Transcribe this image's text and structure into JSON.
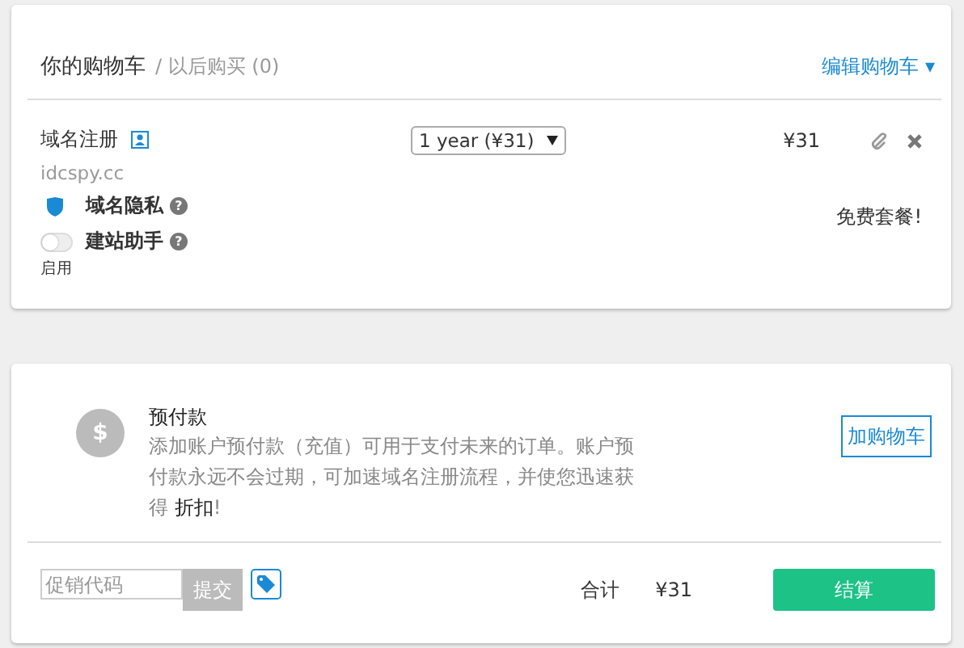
{
  "cart": {
    "title": "你的购物车",
    "later": "/ 以后购买 (0)",
    "edit": "编辑购物车",
    "edit_caret": "▾",
    "items": [
      {
        "name": "域名注册",
        "domain": "idcspy.cc",
        "period": "1 year (¥31)",
        "price": "¥31",
        "note": "免费套餐!",
        "addons": [
          {
            "kind": "shield",
            "label": "域名隐私",
            "help": "?"
          },
          {
            "kind": "toggle",
            "label": "建站助手",
            "help": "?",
            "on": false,
            "toggle_label": "启用"
          }
        ]
      }
    ]
  },
  "prepaid": {
    "icon": "$",
    "title": "预付款",
    "description": "添加账户预付款（充值）可用于支付未来的订单。账户预付款永远不会过期，可加速域名注册流程，并使您迅速获得 **折扣**!",
    "button": "加购物车"
  },
  "footer": {
    "promo": {
      "placeholder": "促销代码"
    },
    "submit": "提交",
    "total_label": "合计",
    "total": "¥31",
    "checkout": "结算"
  }
}
